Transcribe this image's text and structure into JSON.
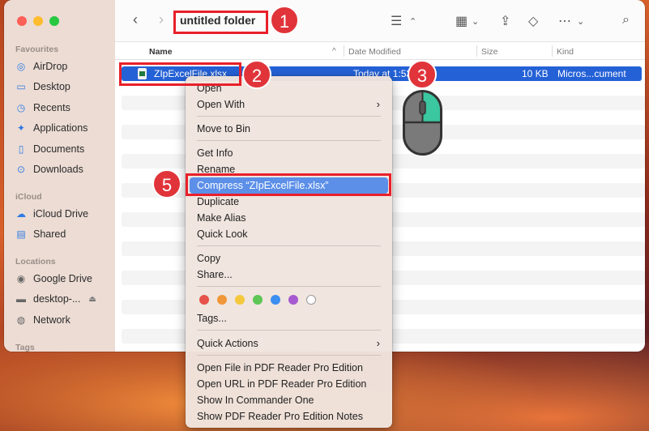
{
  "sidebar": {
    "sections": [
      {
        "heading": "Favourites",
        "items": [
          {
            "label": "AirDrop",
            "icon": "airdrop-icon"
          },
          {
            "label": "Desktop",
            "icon": "desktop-icon"
          },
          {
            "label": "Recents",
            "icon": "clock-icon"
          },
          {
            "label": "Applications",
            "icon": "applications-icon"
          },
          {
            "label": "Documents",
            "icon": "document-icon"
          },
          {
            "label": "Downloads",
            "icon": "download-icon"
          }
        ]
      },
      {
        "heading": "iCloud",
        "items": [
          {
            "label": "iCloud Drive",
            "icon": "cloud-icon"
          },
          {
            "label": "Shared",
            "icon": "shared-folder-icon"
          }
        ]
      },
      {
        "heading": "Locations",
        "items": [
          {
            "label": "Google Drive",
            "icon": "drive-icon"
          },
          {
            "label": "desktop-...",
            "icon": "computer-icon"
          },
          {
            "label": "Network",
            "icon": "network-icon"
          }
        ]
      },
      {
        "heading": "Tags",
        "items": []
      }
    ]
  },
  "toolbar": {
    "title": "untitled folder"
  },
  "columns": {
    "name": "Name",
    "date": "Date Modified",
    "size": "Size",
    "kind": "Kind"
  },
  "file": {
    "name": "ZIpExcelFile.xlsx",
    "date": "Today at 1:53",
    "size": "10 KB",
    "kind": "Micros...cument"
  },
  "menu": {
    "items": {
      "open": "Open",
      "open_with": "Open With",
      "move_to_bin": "Move to Bin",
      "get_info": "Get Info",
      "rename": "Rename",
      "compress": "Compress “ZIpExcelFile.xlsx”",
      "duplicate": "Duplicate",
      "make_alias": "Make Alias",
      "quick_look": "Quick Look",
      "copy": "Copy",
      "share": "Share...",
      "tags": "Tags...",
      "quick_actions": "Quick Actions",
      "pdf_open_file": "Open File in PDF Reader Pro Edition",
      "pdf_open_url": "Open URL in PDF Reader Pro Edition",
      "commander_one": "Show In Commander One",
      "pdf_notes": "Show PDF Reader Pro Edition Notes"
    },
    "tag_colors": [
      "#e5534b",
      "#f0973a",
      "#f4c83b",
      "#5ec654",
      "#3c8ef0",
      "#a65ad0",
      "#ffffff"
    ]
  },
  "callouts": {
    "one": "1",
    "two": "2",
    "three": "3",
    "five": "5"
  },
  "colors": {
    "accent": "#2461d6",
    "highlight": "#5c8fe8",
    "callout": "#e0343a"
  }
}
